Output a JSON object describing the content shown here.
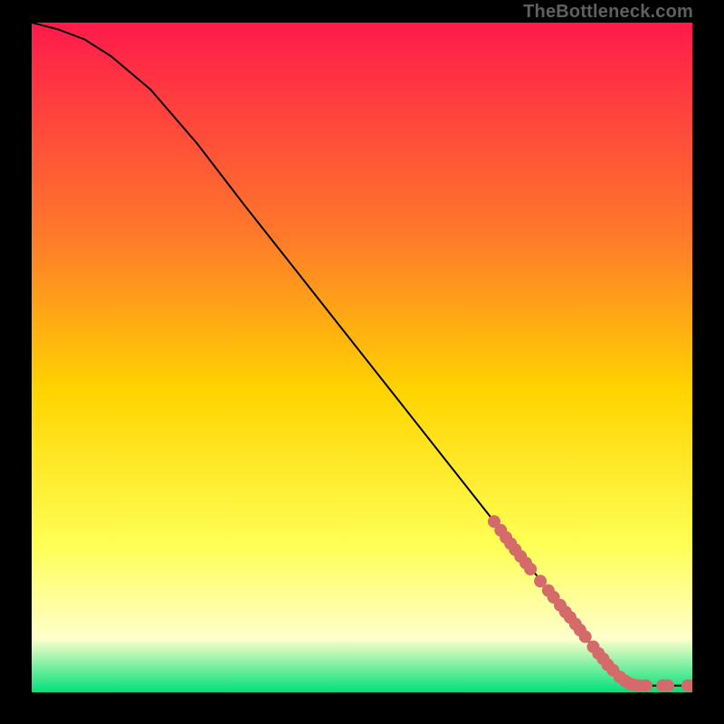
{
  "watermark": "TheBottleneck.com",
  "colors": {
    "gradient_top": "#ff1a4b",
    "gradient_mid1": "#ff7a2a",
    "gradient_mid2": "#ffd400",
    "gradient_mid3": "#ffff55",
    "gradient_mid4": "#ffffcc",
    "gradient_bottom": "#00e07a",
    "curve": "#000000",
    "points": "#d46a6a",
    "frame": "#000000"
  },
  "chart_data": {
    "type": "line",
    "title": "",
    "xlabel": "",
    "ylabel": "",
    "xlim": [
      0,
      100
    ],
    "ylim": [
      0,
      100
    ],
    "grid": false,
    "legend": false,
    "series": [
      {
        "name": "bottleneck-curve",
        "x": [
          0,
          4,
          8,
          12,
          18,
          25,
          32,
          40,
          48,
          56,
          64,
          72,
          78,
          84,
          86,
          88,
          90,
          92,
          94,
          96,
          98,
          100
        ],
        "y": [
          100,
          99,
          97.5,
          95,
          90,
          82,
          73,
          63,
          53,
          43,
          33,
          23,
          15.5,
          8,
          5.5,
          3.5,
          2,
          1.2,
          1.0,
          1.0,
          1.0,
          1.0
        ]
      }
    ],
    "points": [
      {
        "x": 70,
        "y": 25.5
      },
      {
        "x": 71,
        "y": 24.2
      },
      {
        "x": 71.8,
        "y": 23.1
      },
      {
        "x": 72.5,
        "y": 22.2
      },
      {
        "x": 73.2,
        "y": 21.3
      },
      {
        "x": 74,
        "y": 20.3
      },
      {
        "x": 74.8,
        "y": 19.3
      },
      {
        "x": 75.5,
        "y": 18.4
      },
      {
        "x": 77,
        "y": 16.6
      },
      {
        "x": 78.2,
        "y": 15.2
      },
      {
        "x": 79,
        "y": 14.2
      },
      {
        "x": 80,
        "y": 13
      },
      {
        "x": 80.8,
        "y": 12
      },
      {
        "x": 81.5,
        "y": 11.2
      },
      {
        "x": 82.3,
        "y": 10.2
      },
      {
        "x": 83,
        "y": 9.3
      },
      {
        "x": 83.8,
        "y": 8.3
      },
      {
        "x": 85,
        "y": 6.8
      },
      {
        "x": 85.8,
        "y": 5.8
      },
      {
        "x": 86.5,
        "y": 5
      },
      {
        "x": 87.2,
        "y": 4.1
      },
      {
        "x": 88,
        "y": 3.3
      },
      {
        "x": 89,
        "y": 2.3
      },
      {
        "x": 89.8,
        "y": 1.7
      },
      {
        "x": 90.5,
        "y": 1.3
      },
      {
        "x": 91.2,
        "y": 1.1
      },
      {
        "x": 92,
        "y": 1.0
      },
      {
        "x": 93,
        "y": 1.0
      },
      {
        "x": 95.5,
        "y": 1.0
      },
      {
        "x": 96.3,
        "y": 1.0
      },
      {
        "x": 99.3,
        "y": 1.0
      },
      {
        "x": 100,
        "y": 1.0
      }
    ]
  }
}
